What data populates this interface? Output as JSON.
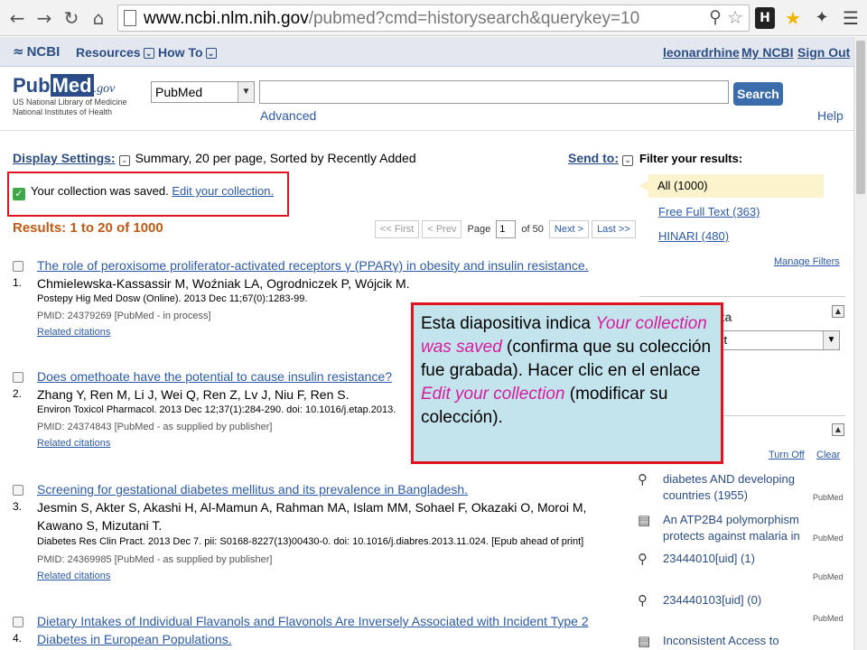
{
  "browser": {
    "url_host": "www.ncbi.nlm.nih.gov",
    "url_path": "/pubmed?cmd=historysearch&querykey=10",
    "ext_label": "H"
  },
  "ncbi_bar": {
    "logo": "NCBI",
    "resources": "Resources",
    "howto": "How To",
    "user": "leonardrhine",
    "my_ncbi": "My NCBI",
    "sign_out": "Sign Out"
  },
  "pubmed_header": {
    "logo_pub": "Pub",
    "logo_med": "Med",
    "logo_gov": ".gov",
    "logo_sub1": "US National Library of Medicine",
    "logo_sub2": "National Institutes of Health",
    "db_selected": "PubMed",
    "search_value": "",
    "search_button": "Search",
    "advanced": "Advanced",
    "help": "Help"
  },
  "display": {
    "label": "Display Settings:",
    "summary": "Summary, 20 per page, Sorted by Recently Added",
    "send_to": "Send to:"
  },
  "saved_message": {
    "text": "Your collection was saved.",
    "link": "Edit your collection."
  },
  "results": {
    "count": "Results: 1 to 20 of 1000",
    "pager": {
      "first": "<< First",
      "prev": "< Prev",
      "page_label": "Page",
      "page": "1",
      "of": "of 50",
      "next": "Next >",
      "last": "Last >>"
    },
    "items": [
      {
        "num": "1.",
        "title": "The role of peroxisome proliferator-activated receptors γ (PPARγ) in obesity and insulin resistance.",
        "authors": "Chmielewska-Kassassir M, Woźniak LA, Ogrodniczek P, Wójcik M.",
        "journal": "Postepy Hig Med Dosw (Online). 2013 Dec 11;67(0):1283-99.",
        "pmid": "PMID: 24379269 [PubMed - in process]",
        "related": "Related citations"
      },
      {
        "num": "2.",
        "title": "Does omethoate have the potential to cause insulin resistance?",
        "authors": "Zhang Y, Ren M, Li J, Wei Q, Ren Z, Lv J, Niu F, Ren S.",
        "journal": "Environ Toxicol Pharmacol. 2013 Dec 12;37(1):284-290. doi: 10.1016/j.etap.2013.",
        "pmid": "PMID: 24374843 [PubMed - as supplied by publisher]",
        "related": "Related citations"
      },
      {
        "num": "3.",
        "title": "Screening for gestational diabetes mellitus and its prevalence in Bangladesh.",
        "authors": "Jesmin S, Akter S, Akashi H, Al-Mamun A, Rahman MA, Islam MM, Sohael F, Okazaki O, Moroi M,",
        "authors2": "Kawano S, Mizutani T.",
        "journal": "Diabetes Res Clin Pract. 2013 Dec 7. pii: S0168-8227(13)00430-0. doi: 10.1016/j.diabres.2013.11.024. [Epub ahead of print]",
        "pmid": "PMID: 24369985 [PubMed - as supplied by publisher]",
        "related": "Related citations"
      },
      {
        "num": "4.",
        "title": "Dietary Intakes of Individual Flavanols and Flavonols Are Inversely Associated with Incident Type 2",
        "title2": "Diabetes in European Populations."
      }
    ]
  },
  "sidebar": {
    "filter_title": "Filter your results:",
    "all": "All (1000)",
    "free_full_text": "Free Full Text (363)",
    "hinari": "HINARI (480)",
    "manage_filters": "Manage Filters",
    "data_label": "ata",
    "select_value": "ct",
    "history_label": "y",
    "turn_off": "Turn Off",
    "clear": "Clear",
    "history": [
      {
        "icon": "search-icon",
        "text": "diabetes AND developing countries (1955)",
        "db": "PubMed"
      },
      {
        "icon": "document-icon",
        "text": "An ATP2B4 polymorphism protects against malaria in",
        "db": "PubMed"
      },
      {
        "icon": "search-icon",
        "text": "23444010[uid] (1)",
        "db": "PubMed"
      },
      {
        "icon": "search-icon",
        "text": "234440103[uid] (0)",
        "db": "PubMed"
      },
      {
        "icon": "document-icon",
        "text": "Inconsistent Access to Food and",
        "db": ""
      }
    ]
  },
  "callout": {
    "t1": "Esta diapositiva indica ",
    "e1": "Your collection was saved",
    "t2": " (confirma que su colección fue grabada). Hacer clic en el enlace ",
    "e2": "Edit your collection",
    "t3": " (modificar su colección)."
  },
  "colors": {
    "callout_bg": "#c3e4ec",
    "callout_border": "#e0141e",
    "callout_emphasis": "#d61c9c",
    "highlight_box": "#e0141e",
    "results_count": "#c05a14",
    "link": "#2c5aa8"
  }
}
